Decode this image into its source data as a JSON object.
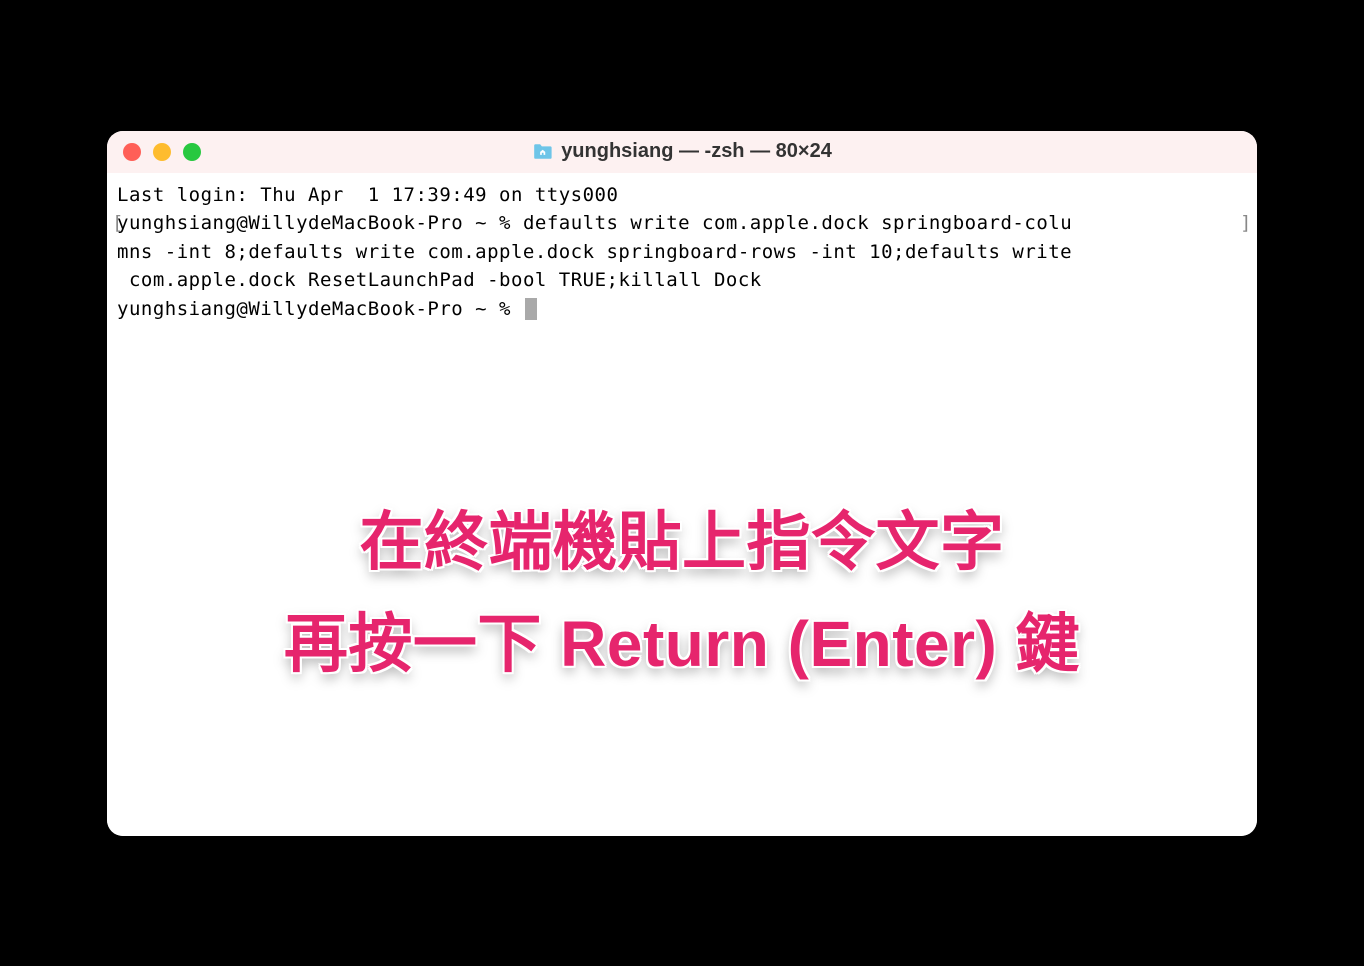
{
  "window": {
    "title": "yunghsiang — -zsh — 80×24"
  },
  "terminal": {
    "last_login": "Last login: Thu Apr  1 17:39:49 on ttys000",
    "prompt_prefix": "yunghsiang@WillydeMacBook-Pro ~ % ",
    "command_line1": "defaults write com.apple.dock springboard-colu",
    "command_line2": "mns -int 8;defaults write com.apple.dock springboard-rows -int 10;defaults write",
    "command_line3": " com.apple.dock ResetLaunchPad -bool TRUE;killall Dock",
    "prompt_after": "yunghsiang@WillydeMacBook-Pro ~ % "
  },
  "overlay": {
    "line1": "在終端機貼上指令文字",
    "line2": "再按一下 Return (Enter) 鍵"
  },
  "colors": {
    "close": "#ff5f57",
    "minimize": "#febc2e",
    "maximize": "#28c840",
    "accent": "#e6256d"
  }
}
